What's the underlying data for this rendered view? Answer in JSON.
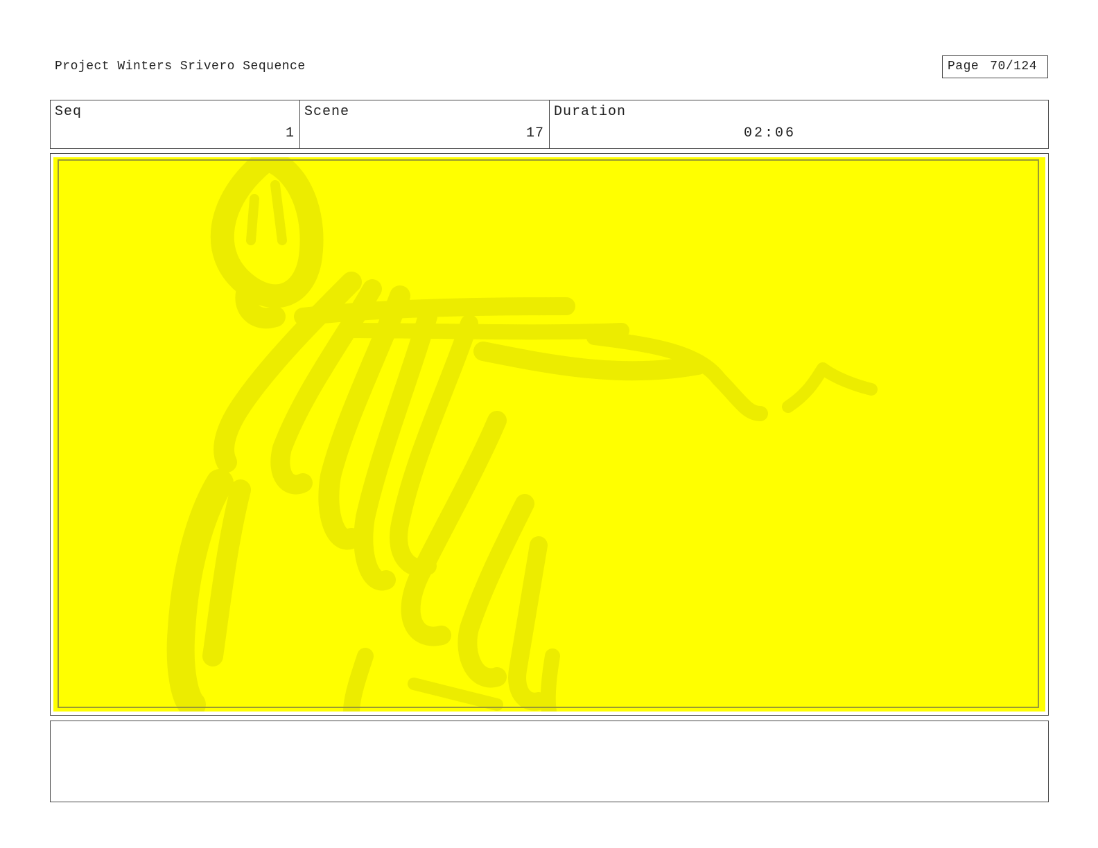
{
  "header": {
    "project_title": "Project Winters Srivero Sequence",
    "page_label": "Page",
    "page_number": "70/124"
  },
  "info": {
    "seq_label": "Seq",
    "seq_value": "1",
    "scene_label": "Scene",
    "scene_value": "17",
    "duration_label": "Duration",
    "duration_value": "02:06"
  },
  "frame": {
    "background_color": "#ffff00",
    "sketch_color": "#eaea00"
  },
  "notes": {
    "text": ""
  }
}
